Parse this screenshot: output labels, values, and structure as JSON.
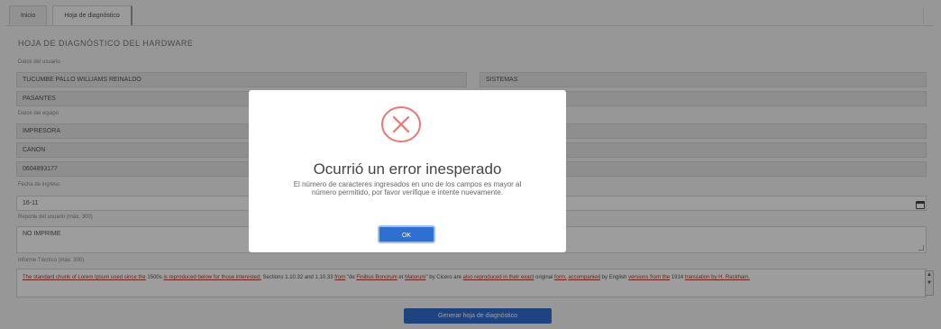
{
  "tabs": [
    {
      "label": "Inicio"
    },
    {
      "label": "Hoja de diagnóstico"
    }
  ],
  "form": {
    "title": "HOJA DE DIAGNÓSTICO DEL HARDWARE",
    "user_section_label": "Datos del usuario",
    "user_name": "TUCUMBE PALLO WILLIAMS REINALDO",
    "user_area": "SISTEMAS",
    "user_building": "PASANTES",
    "equipment_section_label": "Datos del equipo",
    "equipment_type": "IMPRESORA",
    "equipment_brand": "CANON",
    "equipment_code": "0604893177",
    "date_label": "Fecha de ingreso",
    "date_value": "16-11",
    "problem_label": "Reporte del usuario (máx. 300)",
    "problem_value": "NO IMPRIME",
    "diagnosis_label": "Informe Técnico (máx. 300)",
    "diagnosis_segments": [
      {
        "text": "The standard chunk of Lorem Ipsum used since the",
        "style": "red"
      },
      {
        "text": " 1500s ",
        "style": "plain"
      },
      {
        "text": "is reproduced below for those interested.",
        "style": "red"
      },
      {
        "text": " Sections 1.10.32 and 1.10.33 ",
        "style": "plain"
      },
      {
        "text": "from",
        "style": "red"
      },
      {
        "text": " \"de ",
        "style": "plain"
      },
      {
        "text": "Finibus Bonorum",
        "style": "red"
      },
      {
        "text": " et ",
        "style": "plain"
      },
      {
        "text": "Malorum",
        "style": "red"
      },
      {
        "text": "\" by Cicero are ",
        "style": "plain"
      },
      {
        "text": "also reproduced in their exact",
        "style": "red"
      },
      {
        "text": " original ",
        "style": "plain"
      },
      {
        "text": "form,",
        "style": "red"
      },
      {
        "text": " ",
        "style": "plain"
      },
      {
        "text": "accompanied",
        "style": "red"
      },
      {
        "text": " by English ",
        "style": "plain"
      },
      {
        "text": "versions from the",
        "style": "red"
      },
      {
        "text": " 1914 ",
        "style": "plain"
      },
      {
        "text": "translation by H. Rackham.",
        "style": "red"
      }
    ],
    "submit_label": "Generar hoja de diagnóstico"
  },
  "modal": {
    "title": "Ocurrió un error inesperado",
    "message": "El número de caracteres ingresados en uno de los campos es mayor al número permitido, por favor verifique e intente nuevamente.",
    "ok_label": "OK",
    "icon": "error-x-icon",
    "icon_color": "#f27474",
    "button_color": "#2f6fd1"
  }
}
